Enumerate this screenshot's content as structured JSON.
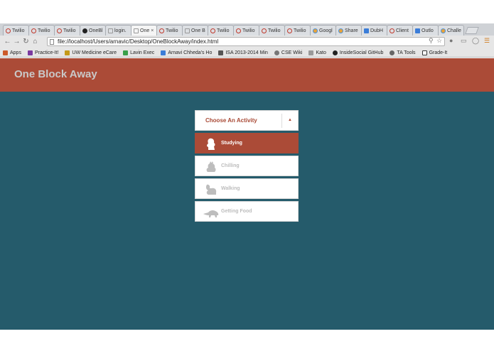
{
  "browser": {
    "tabs": [
      {
        "label": "Twilio",
        "icon": "blocked-icon"
      },
      {
        "label": "Twilio",
        "icon": "blocked-icon"
      },
      {
        "label": "Twilio",
        "icon": "blocked-icon"
      },
      {
        "label": "OneBl",
        "icon": "github-icon"
      },
      {
        "label": "login.",
        "icon": "page-icon"
      },
      {
        "label": "One",
        "icon": "page-icon",
        "active": true
      },
      {
        "label": "Twilio",
        "icon": "blocked-icon"
      },
      {
        "label": "One B",
        "icon": "page-icon"
      },
      {
        "label": "Twilio",
        "icon": "blocked-icon"
      },
      {
        "label": "Twilio",
        "icon": "blocked-icon"
      },
      {
        "label": "Twilio",
        "icon": "blocked-icon"
      },
      {
        "label": "Twilio",
        "icon": "blocked-icon"
      },
      {
        "label": "Googl",
        "icon": "google-icon"
      },
      {
        "label": "Share",
        "icon": "drive-icon"
      },
      {
        "label": "DubH",
        "icon": "doc-icon"
      },
      {
        "label": "Client",
        "icon": "blocked-icon"
      },
      {
        "label": "Outlo",
        "icon": "outlook-icon"
      },
      {
        "label": "Challe",
        "icon": "multi-icon"
      }
    ],
    "active_tab_close": "×",
    "url": "file://localhost/Users/arnavic/Desktop/OneBlockAway/index.html",
    "bookmarks": [
      {
        "label": "Apps",
        "icon": "apps-icon"
      },
      {
        "label": "Practice-It!",
        "icon": "bookmark-icon"
      },
      {
        "label": "UW Medicine eCare",
        "icon": "folder-icon"
      },
      {
        "label": "Lavin Exec",
        "icon": "drive-icon"
      },
      {
        "label": "Arnavi Chheda's Ho",
        "icon": "calendar-icon"
      },
      {
        "label": "ISA 2013-2014 Min",
        "icon": "building-icon"
      },
      {
        "label": "CSE Wiki",
        "icon": "wiki-icon"
      },
      {
        "label": "Kato",
        "icon": "cat-icon"
      },
      {
        "label": "InsideSocial GitHub",
        "icon": "github-icon"
      },
      {
        "label": "TA Tools",
        "icon": "tool-icon"
      },
      {
        "label": "Grade-It",
        "icon": "check-icon"
      }
    ]
  },
  "app": {
    "title": "One Block Away",
    "dropdown": {
      "label": "Choose An Activity",
      "caret": "▲"
    },
    "options": [
      {
        "label": "Studying",
        "icon": "thinker-icon",
        "selected": true
      },
      {
        "label": "Chilling",
        "icon": "cat-icon",
        "selected": false
      },
      {
        "label": "Walking",
        "icon": "squirrel-icon",
        "selected": false
      },
      {
        "label": "Getting Food",
        "icon": "anteater-icon",
        "selected": false
      }
    ]
  },
  "colors": {
    "header": "#ab4b37",
    "background": "#255b6b",
    "selected_option": "#ab4b37",
    "inactive_icon": "#bdbdbd"
  }
}
